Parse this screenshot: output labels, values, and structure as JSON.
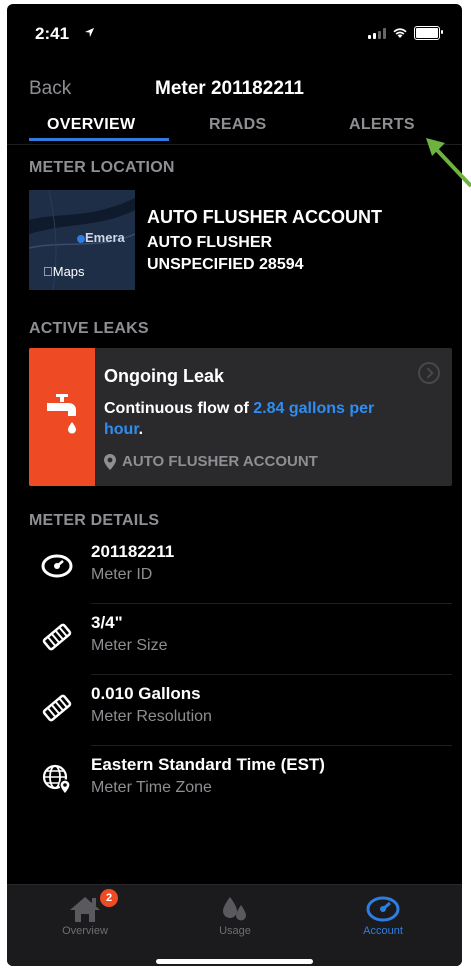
{
  "status_bar": {
    "time": "2:41"
  },
  "nav": {
    "back_label": "Back",
    "title": "Meter 201182211"
  },
  "tabs": [
    {
      "label": "OVERVIEW",
      "active": true
    },
    {
      "label": "READS",
      "active": false
    },
    {
      "label": "ALERTS",
      "active": false
    }
  ],
  "meter_location": {
    "section_title": "METER LOCATION",
    "map_label": "Emera",
    "maps_brand": "Maps",
    "account_name": "AUTO FLUSHER ACCOUNT",
    "address_line1": "AUTO FLUSHER",
    "address_line2": "UNSPECIFIED 28594"
  },
  "active_leaks": {
    "section_title": "ACTIVE LEAKS",
    "leak": {
      "title": "Ongoing Leak",
      "desc_prefix": "Continuous flow of ",
      "rate": "2.84 gallons per hour",
      "desc_suffix": ".",
      "location": "AUTO FLUSHER ACCOUNT"
    }
  },
  "meter_details": {
    "section_title": "METER DETAILS",
    "items": [
      {
        "value": "201182211",
        "label": "Meter ID",
        "icon": "meter-icon"
      },
      {
        "value": "3/4\"",
        "label": "Meter Size",
        "icon": "pipe-icon"
      },
      {
        "value": "0.010 Gallons",
        "label": "Meter Resolution",
        "icon": "pipe-icon"
      },
      {
        "value": "Eastern Standard Time (EST)",
        "label": "Meter Time Zone",
        "icon": "globe-pin-icon"
      }
    ]
  },
  "tab_bar": {
    "items": [
      {
        "label": "Overview",
        "badge": "2",
        "icon": "home-icon",
        "active": false
      },
      {
        "label": "Usage",
        "icon": "drops-icon",
        "active": false
      },
      {
        "label": "Account",
        "icon": "gauge-icon",
        "active": true
      }
    ]
  },
  "colors": {
    "accent_blue": "#2f7de1",
    "leak_red": "#ee4a23",
    "annotation_green": "#6cb33f"
  }
}
